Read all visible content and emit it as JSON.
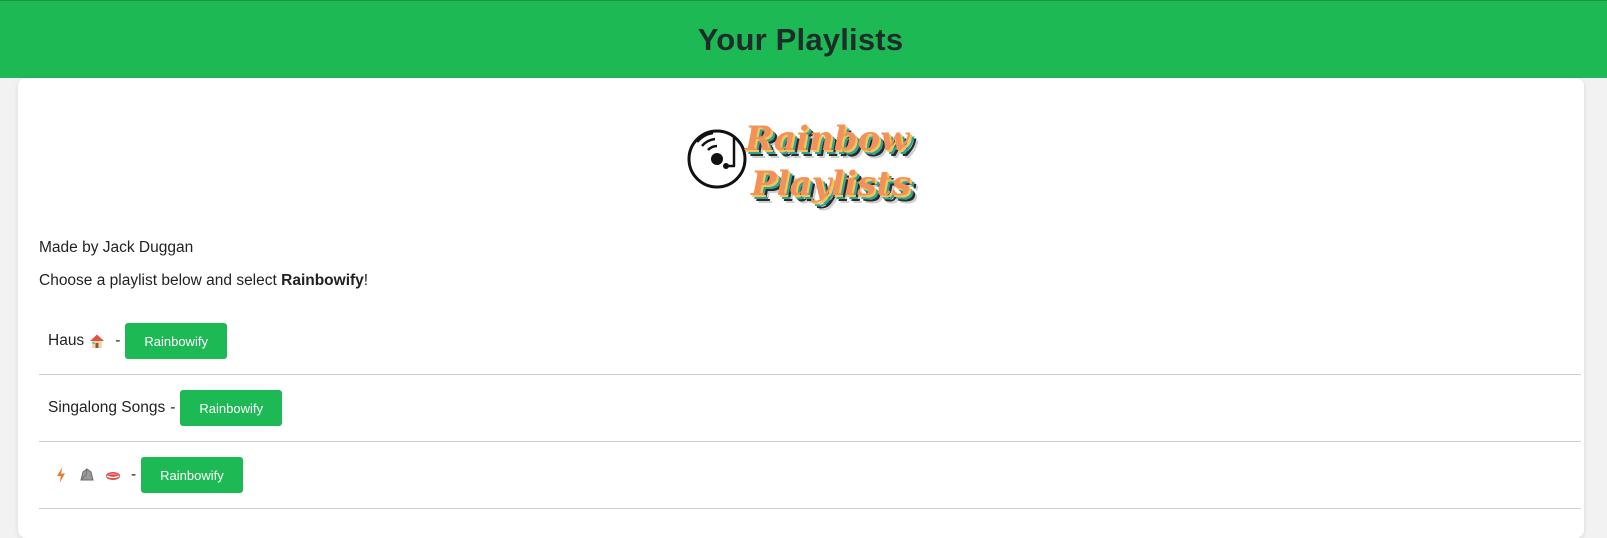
{
  "header": {
    "title": "Your Playlists"
  },
  "logo": {
    "line1": "Rainbow",
    "line2": "Playlists",
    "icon": "vinyl-record-icon"
  },
  "intro": {
    "made_by": "Made by Jack Duggan",
    "instructions_prefix": "Choose a playlist below and select ",
    "instructions_bold": "Rainbowify",
    "instructions_suffix": "!"
  },
  "playlists": [
    {
      "name": "Haus",
      "emojis": [
        "house-emoji"
      ],
      "separator": "-",
      "button_label": "Rainbowify"
    },
    {
      "name": "Singalong Songs",
      "emojis": [],
      "separator": "-",
      "button_label": "Rainbowify"
    },
    {
      "name": "",
      "emojis": [
        "lightning-emoji",
        "rock-emoji",
        "lips-emoji"
      ],
      "separator": "-",
      "button_label": "Rainbowify"
    }
  ],
  "colors": {
    "brand_green": "#1db954",
    "header_text": "#1f2d2a",
    "logo_orange": "#f2925a",
    "logo_teal": "#2aa59a",
    "logo_yellow": "#f5c451"
  }
}
